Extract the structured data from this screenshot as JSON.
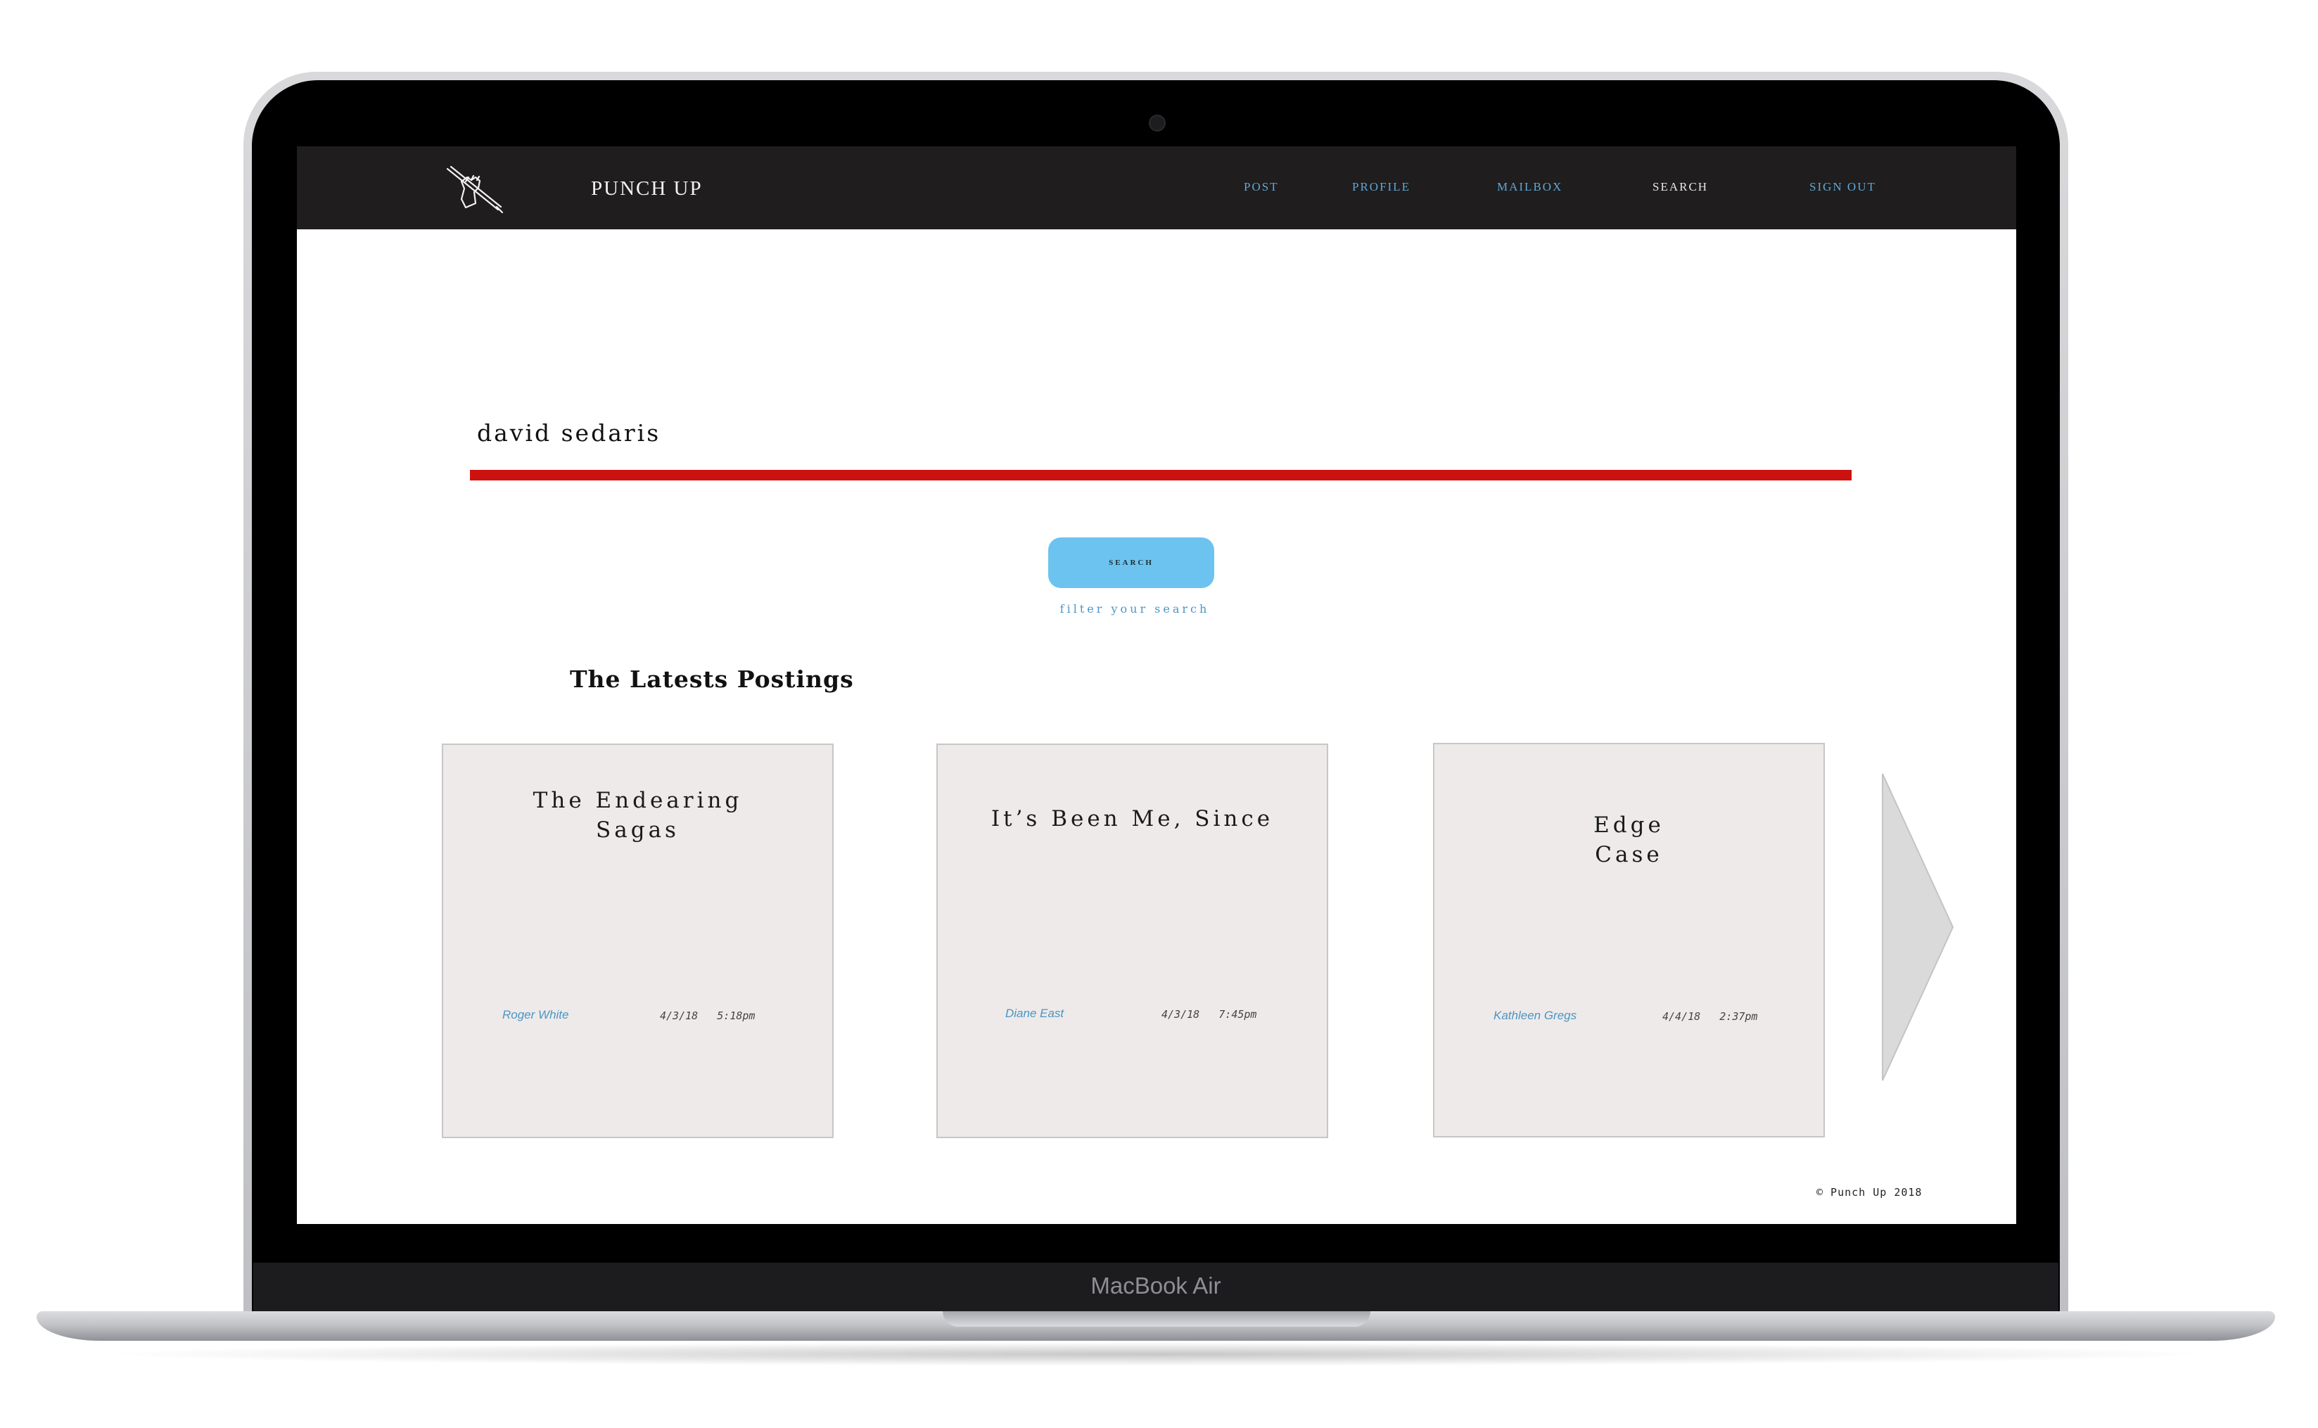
{
  "device": {
    "label": "MacBook Air"
  },
  "nav": {
    "brand": "PUNCH UP",
    "items": [
      {
        "label": "POST",
        "active": false
      },
      {
        "label": "PROFILE",
        "active": false
      },
      {
        "label": "MAILBOX",
        "active": false
      },
      {
        "label": "SEARCH",
        "active": true
      },
      {
        "label": "SIGN OUT",
        "active": false
      }
    ]
  },
  "search": {
    "query": "david sedaris",
    "button_label": "SEARCH",
    "filter_link": "filter your search"
  },
  "postings": {
    "title": "The Latests Postings",
    "cards": [
      {
        "title_lines": [
          "The Endearing",
          "Sagas"
        ],
        "author": "Roger White",
        "date": "4/3/18",
        "time": "5:18pm"
      },
      {
        "title_lines": [
          "It’s Been Me, Since"
        ],
        "author": "Diane East",
        "date": "4/3/18",
        "time": "7:45pm"
      },
      {
        "title_lines": [
          "Edge",
          "Case"
        ],
        "author": "Kathleen Gregs",
        "date": "4/4/18",
        "time": "2:37pm"
      }
    ],
    "next_icon": "chevron-right-icon"
  },
  "footer": {
    "copyright": "© Punch Up 2018"
  },
  "colors": {
    "navbar_bg": "#1f1d1d",
    "nav_link": "#5fa8d8",
    "nav_active": "#e8e8e8",
    "accent_red": "#cc1111",
    "search_button": "#6cc3ef",
    "card_bg": "#eeeaea",
    "author_link": "#4a96c4"
  }
}
